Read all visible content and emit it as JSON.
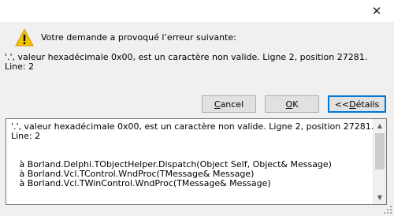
{
  "dialog": {
    "close_glyph": "✕",
    "header_text": "Votre demande a provoqué l’erreur suivante:",
    "message": "'.', valeur hexadécimale 0x00, est un caractère non valide. Ligne 2, position 27281.\nLine: 2",
    "icon": "warning-icon"
  },
  "buttons": {
    "cancel_mnemonic": "C",
    "cancel_rest": "ancel",
    "ok_mnemonic": "O",
    "ok_rest": "K",
    "details_prefix": "<<",
    "details_mnemonic": "D",
    "details_rest": "étails"
  },
  "details": {
    "text": "'.', valeur hexadécimale 0x00, est un caractère non valide. Ligne 2, position 27281.\nLine: 2\n\n\n   à Borland.Delphi.TObjectHelper.Dispatch(Object Self, Object& Message)\n   à Borland.Vcl.TControl.WndProc(TMessage& Message)\n   à Borland.Vcl.TWinControl.WndProc(TMessage& Message)"
  },
  "colors": {
    "warning_yellow": "#f4c300",
    "focus_blue": "#0078d7"
  }
}
